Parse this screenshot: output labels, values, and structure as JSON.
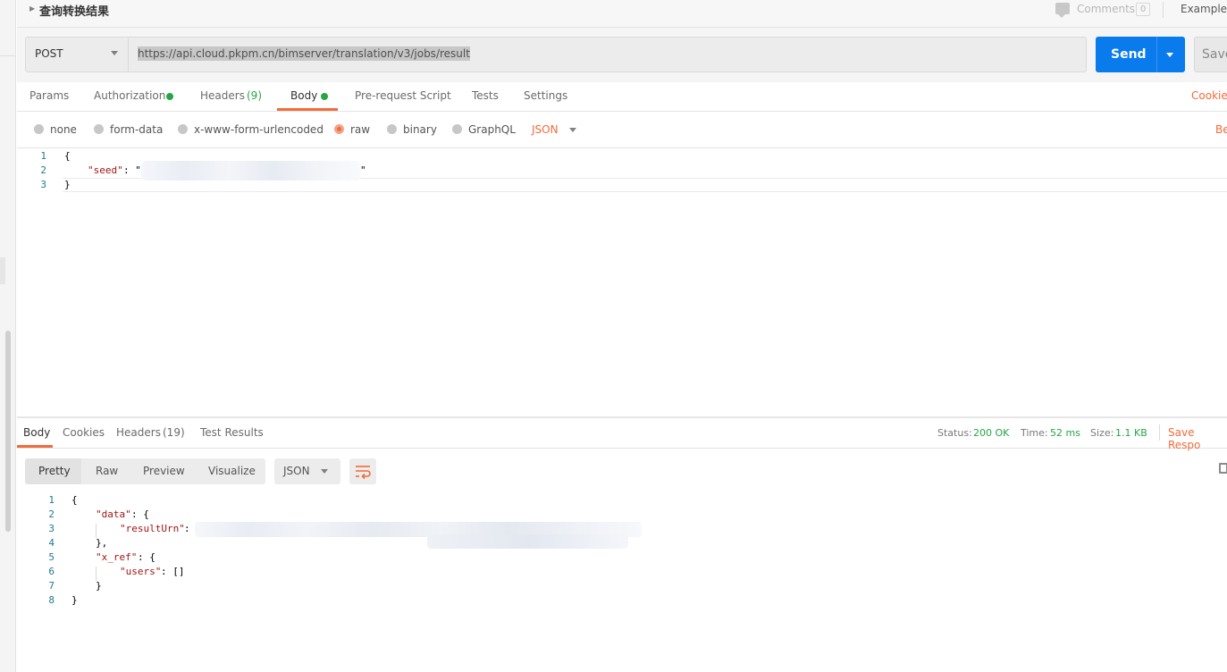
{
  "header": {
    "request_title": "查询转换结果",
    "comments_label": "Comments",
    "comments_count": "0",
    "examples_label": "Examples"
  },
  "url_bar": {
    "method": "POST",
    "url": "https://api.cloud.pkpm.cn/bimserver/translation/v3/jobs/result",
    "send_label": "Send",
    "save_label": "Save"
  },
  "request_tabs": [
    {
      "label": "Params"
    },
    {
      "label": "Authorization"
    },
    {
      "label": "Headers",
      "count": "(9)"
    },
    {
      "label": "Body"
    },
    {
      "label": "Pre-request Script"
    },
    {
      "label": "Tests"
    },
    {
      "label": "Settings"
    }
  ],
  "cookies_link": "Cookies",
  "body_types": [
    "none",
    "form-data",
    "x-www-form-urlencoded",
    "raw",
    "binary",
    "GraphQL"
  ],
  "body_type_selected": "raw",
  "body_format": "JSON",
  "beautify_link": "Be",
  "request_editor": {
    "line_numbers": [
      "1",
      "2",
      "3"
    ],
    "open_brace": "{",
    "seed_key": "\"seed\"",
    "seed_sep": ": \"",
    "seed_close": "\"",
    "close_brace": "}"
  },
  "response_tabs": [
    {
      "label": "Body"
    },
    {
      "label": "Cookies"
    },
    {
      "label": "Headers",
      "count": "(19)"
    },
    {
      "label": "Test Results"
    }
  ],
  "response_meta": {
    "status_label": "Status:",
    "status_value": "200 OK",
    "time_label": "Time:",
    "time_value": "52 ms",
    "size_label": "Size:",
    "size_value": "1.1 KB",
    "save_response": "Save Respo"
  },
  "response_views": [
    "Pretty",
    "Raw",
    "Preview",
    "Visualize"
  ],
  "response_format": "JSON",
  "response_editor": {
    "line_numbers": [
      "1",
      "2",
      "3",
      "4",
      "5",
      "6",
      "7",
      "8"
    ],
    "l1": "{",
    "l2_key": "\"data\"",
    "l2_rest": ": {",
    "l3_key": "\"resultUrn\"",
    "l3_rest": ":",
    "l4": "},",
    "l5_key": "\"x_ref\"",
    "l5_rest": ": {",
    "l6_key": "\"users\"",
    "l6_rest": ": []",
    "l7": "}",
    "l8": "}"
  },
  "colors": {
    "accent": "#f26b3a",
    "send_blue": "#097bed",
    "status_green": "#26a547"
  }
}
